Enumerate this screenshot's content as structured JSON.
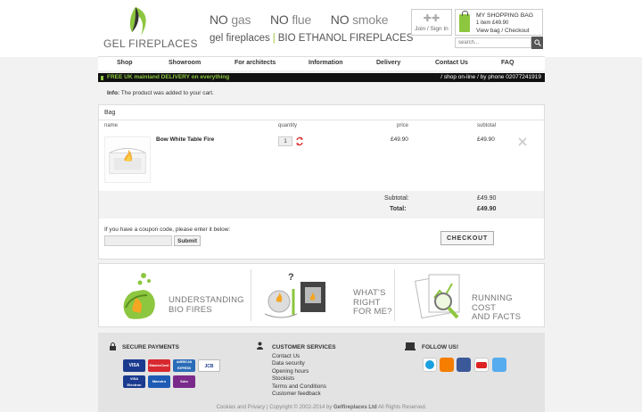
{
  "header": {
    "logo_text": "GEL FIREPLACES",
    "taglines": [
      {
        "no": "NO",
        "word": "gas"
      },
      {
        "no": "NO",
        "word": "flue"
      },
      {
        "no": "NO",
        "word": "smoke"
      }
    ],
    "subline_left": "gel fireplaces",
    "subline_right": "BIO ETHANOL FIREPLACES",
    "join_label": "Join / Sign In",
    "bag_title": "MY SHOPPING BAG",
    "bag_summary": "1 item £49.90",
    "bag_links": "View bag / Checkout",
    "search_placeholder": "search..."
  },
  "nav": {
    "items": [
      "Shop",
      "Showroom",
      "For architects",
      "Information",
      "Delivery",
      "Contact Us",
      "FAQ"
    ]
  },
  "promo": {
    "left": "FREE UK mainland DELIVERY on everything",
    "right": "/ shop on-line / by phone 02077241919"
  },
  "info": {
    "label": "Info:",
    "message": "The product was added to your cart."
  },
  "bag": {
    "title": "Bag",
    "columns": {
      "name": "name",
      "quantity": "quantity",
      "price": "price",
      "subtotal": "subtotal"
    },
    "items": [
      {
        "name": "Bow White Table Fire",
        "quantity": "1",
        "price": "£49.90",
        "subtotal": "£49.90"
      }
    ],
    "subtotal_label": "Subtotal:",
    "subtotal_value": "£49.90",
    "total_label": "Total:",
    "total_value": "£49.90",
    "coupon_label": "If you have a coupon code, please enter it below:",
    "coupon_button": "Submit",
    "checkout_button": "CHECKOUT"
  },
  "banners": [
    {
      "line1": "UNDERSTANDING",
      "line2": "BIO FIRES",
      "line3": ""
    },
    {
      "line1": "WHAT'S",
      "line2": "RIGHT",
      "line3": "FOR ME?"
    },
    {
      "line1": "RUNNING",
      "line2": "COST",
      "line3": "AND FACTS"
    }
  ],
  "footer": {
    "secure_title": "SECURE PAYMENTS",
    "cards": [
      "VISA",
      "MasterCard",
      "AMERICAN EXPRESS",
      "JCB",
      "VISA Electron",
      "Maestro",
      "Solo"
    ],
    "services_title": "CUSTOMER SERVICES",
    "services_links": [
      "Contact Us",
      "Data security",
      "Opening hours",
      "Stockists",
      "Terms and Conditions",
      "Customer feedback"
    ],
    "follow_title": "FOLLOW US!",
    "social": [
      "skype",
      "blogger",
      "facebook",
      "youtube",
      "twitter"
    ],
    "copyright_left": "Cookies and Privacy | Copyright © 2002-2014 by",
    "copyright_brand": "Gelfireplaces Ltd",
    "copyright_right": "All Rights Reserved."
  },
  "colors": {
    "brand_green": "#8dc63f",
    "promo_bg": "#111111",
    "remove_x": "#cccccc"
  }
}
